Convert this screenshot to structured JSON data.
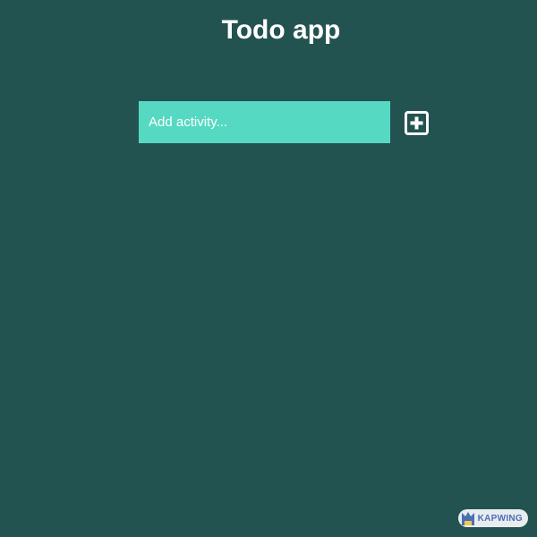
{
  "app": {
    "title": "Todo app"
  },
  "add_activity": {
    "placeholder": "Add activity...",
    "value": "",
    "add_icon": "plus-square-icon"
  },
  "watermark": {
    "text": "KAPWING",
    "logo_icon": "kapwing-logo-icon"
  },
  "colors": {
    "background": "#235351",
    "input_background": "#56d9c2",
    "text": "#ffffff"
  }
}
